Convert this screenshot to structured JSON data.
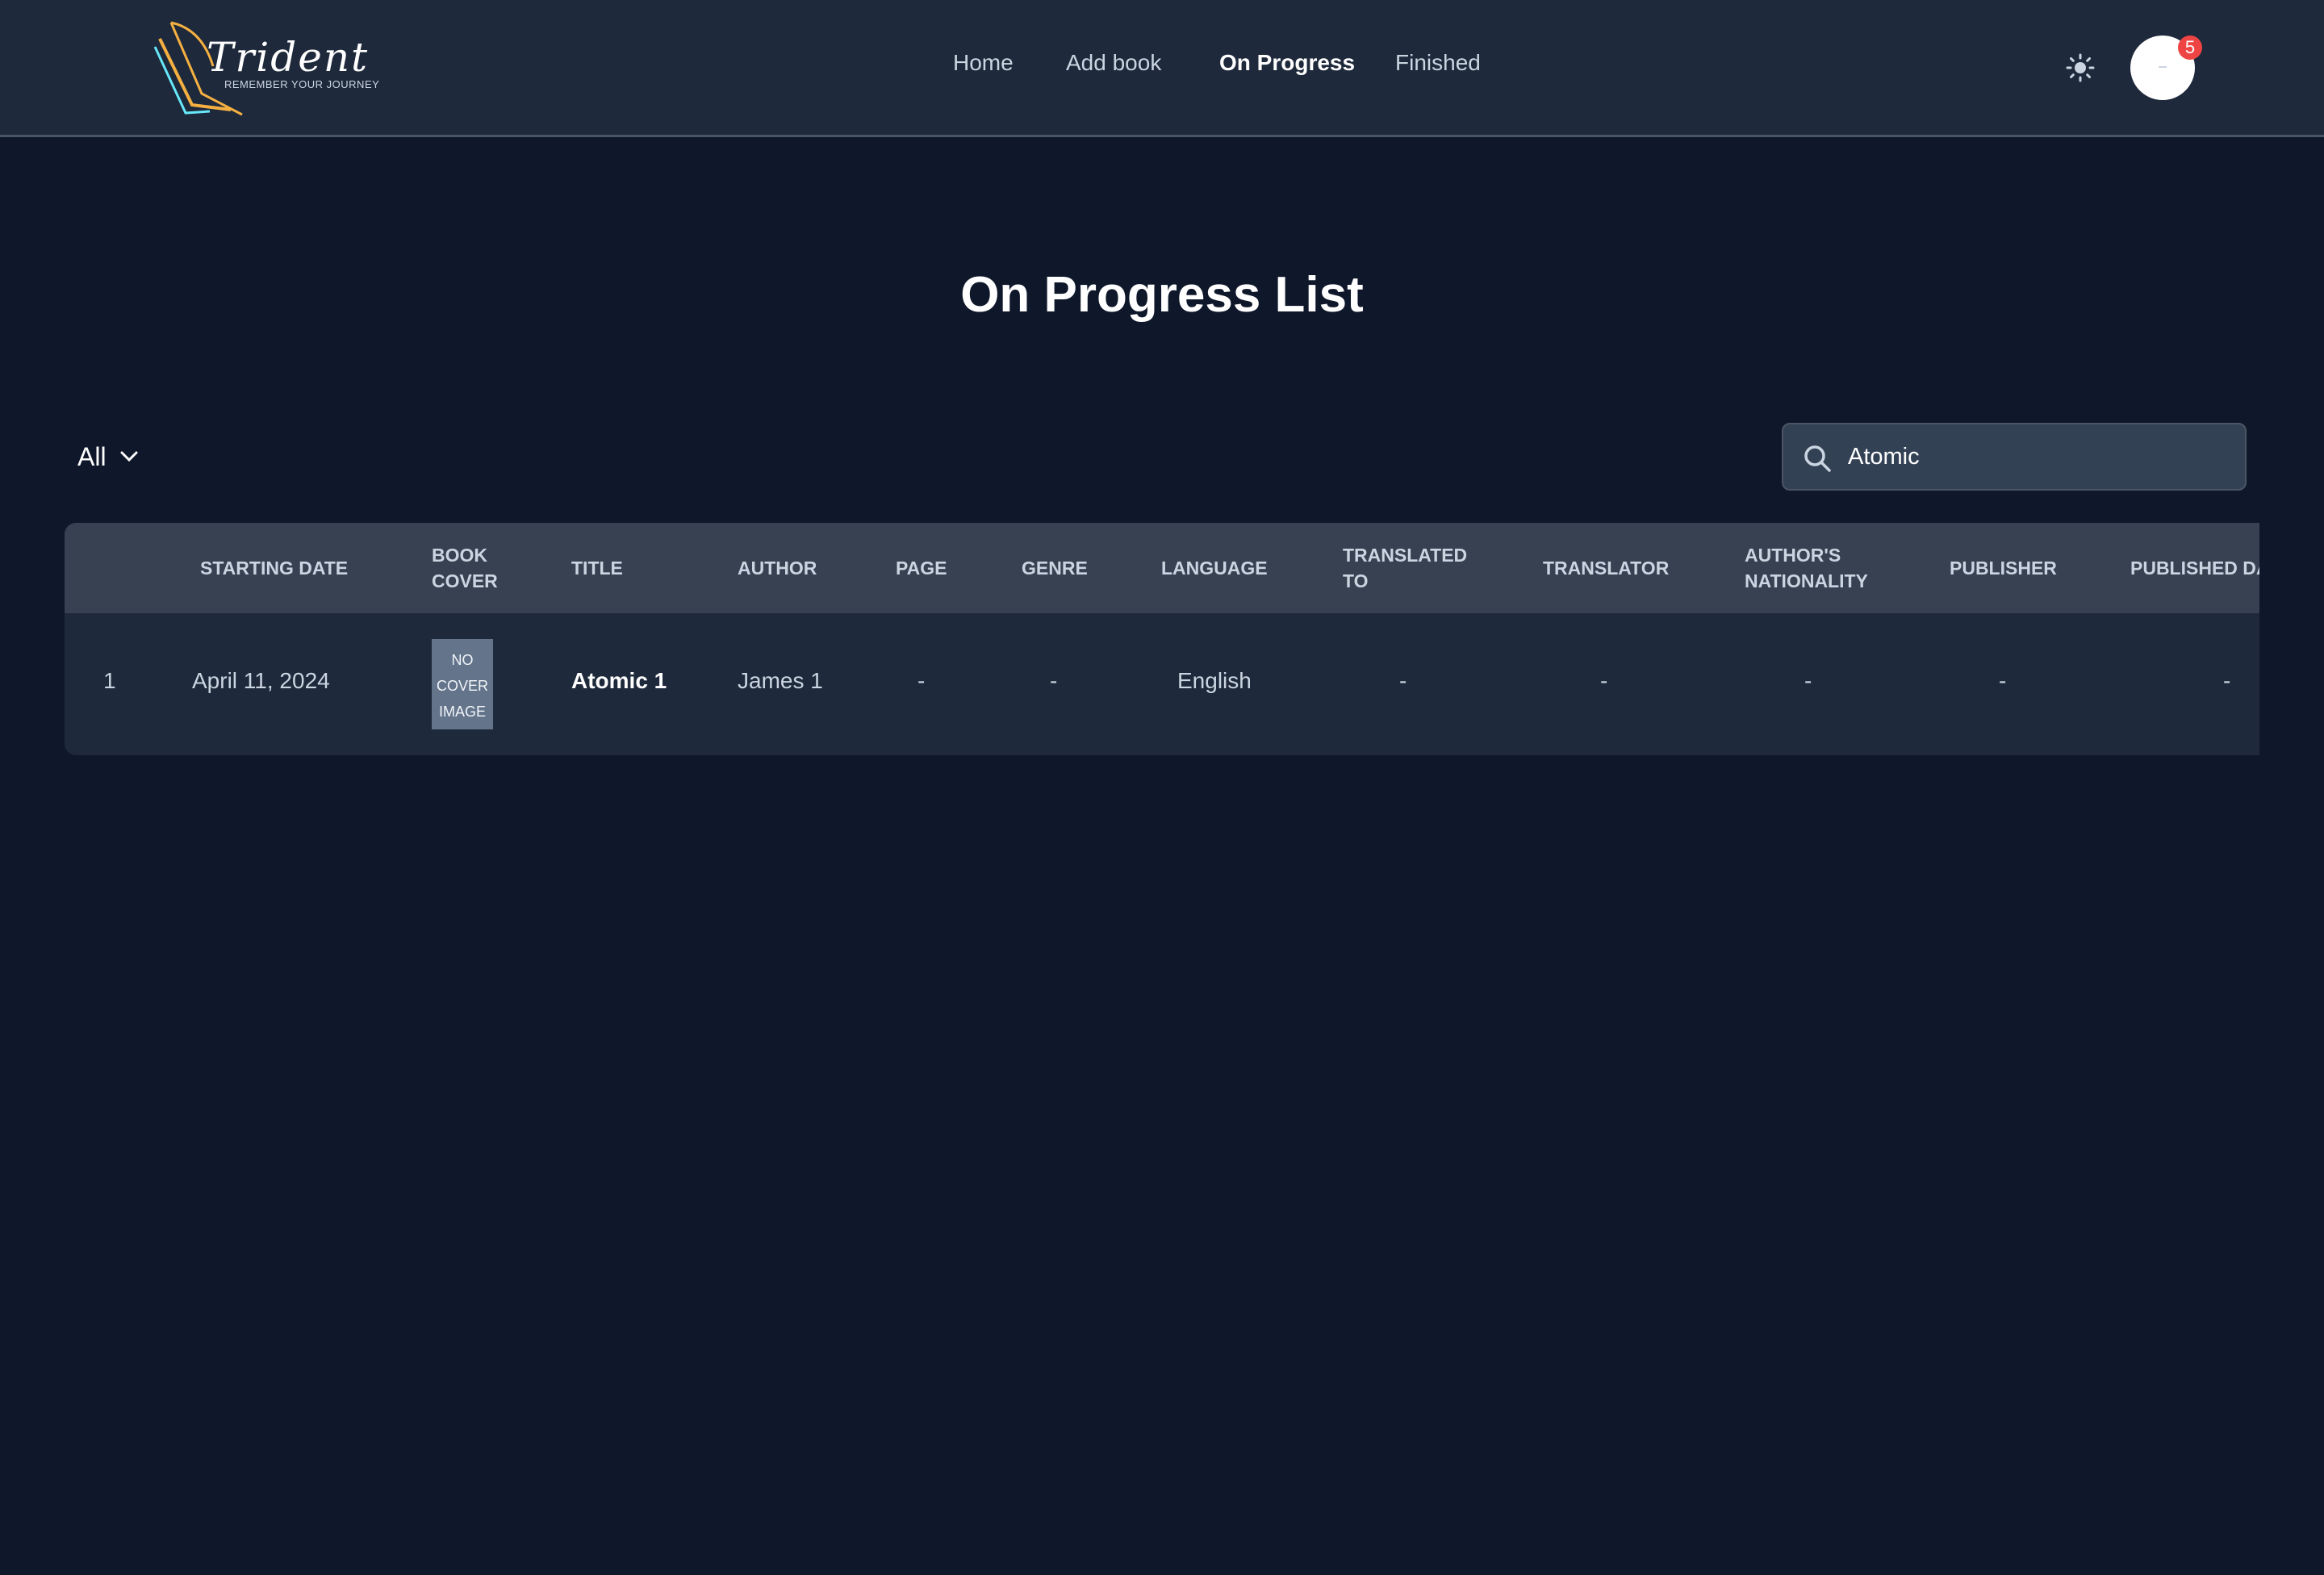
{
  "logo": {
    "wordmark": "Trident",
    "tagline": "REMEMBER YOUR JOURNEY"
  },
  "nav": {
    "home": "Home",
    "add_book": "Add book",
    "on_progress": "On Progress",
    "finished": "Finished"
  },
  "header": {
    "theme_icon": "sun-icon",
    "notification_count": "5"
  },
  "page": {
    "title": "On Progress List"
  },
  "filter": {
    "selected": "All"
  },
  "search": {
    "value": "Atomic",
    "icon": "search-icon"
  },
  "table": {
    "headers": {
      "starting_date": "STARTING DATE",
      "book_cover_1": "BOOK",
      "book_cover_2": "COVER",
      "title": "TITLE",
      "author": "AUTHOR",
      "page": "PAGE",
      "genre": "GENRE",
      "language": "LANGUAGE",
      "translated_to_1": "TRANSLATED",
      "translated_to_2": "TO",
      "translator": "TRANSLATOR",
      "nationality_1": "AUTHOR'S",
      "nationality_2": "NATIONALITY",
      "publisher": "PUBLISHER",
      "published_date": "PUBLISHED DA"
    },
    "rows": [
      {
        "index": "1",
        "starting_date": "April 11, 2024",
        "cover_1": "NO",
        "cover_2": "COVER",
        "cover_3": "IMAGE",
        "title": "Atomic 1",
        "author": "James 1",
        "page": "-",
        "genre": "-",
        "language": "English",
        "translated_to": "-",
        "translator": "-",
        "nationality": "-",
        "publisher": "-",
        "published_date": "-"
      }
    ]
  },
  "colors": {
    "background": "#0f172a",
    "navbar": "#1e293b",
    "table_header": "#374151",
    "badge": "#ef4444",
    "logo_gold": "#f5b041",
    "logo_cyan": "#67e8f9"
  }
}
